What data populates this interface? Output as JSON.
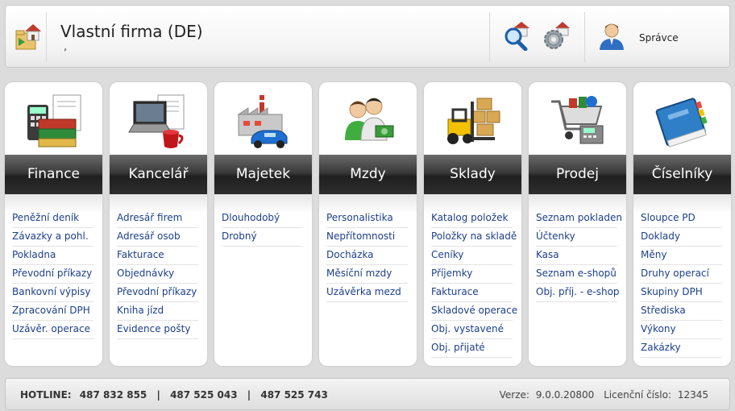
{
  "header": {
    "company": "Vlastní firma (DE)",
    "subline": ",",
    "user": "Správce"
  },
  "modules": [
    {
      "title": "Finance",
      "icon": "finance-icon",
      "links": [
        "Peněžní deník",
        "Závazky a pohl.",
        "Pokladna",
        "Převodní příkazy",
        "Bankovní výpisy",
        "Zpracování DPH",
        "Uzávěr. operace"
      ]
    },
    {
      "title": "Kancelář",
      "icon": "office-icon",
      "links": [
        "Adresář firem",
        "Adresář osob",
        "Fakturace",
        "Objednávky",
        "Převodní příkazy",
        "Kniha jízd",
        "Evidence pošty"
      ]
    },
    {
      "title": "Majetek",
      "icon": "property-icon",
      "links": [
        "Dlouhodobý",
        "Drobný"
      ]
    },
    {
      "title": "Mzdy",
      "icon": "payroll-icon",
      "links": [
        "Personalistika",
        "Nepřítomnosti",
        "Docházka",
        "Měsíční mzdy",
        "Uzávěrka mezd"
      ]
    },
    {
      "title": "Sklady",
      "icon": "warehouse-icon",
      "links": [
        "Katalog položek",
        "Položky na skladě",
        "Ceníky",
        "Příjemky",
        "Fakturace",
        "Skladové operace",
        "Obj. vystavené",
        "Obj. přijaté"
      ]
    },
    {
      "title": "Prodej",
      "icon": "sales-icon",
      "links": [
        "Seznam pokladen",
        "Účtenky",
        "Kasa",
        "Seznam e-shopů",
        "Obj. příj. - e-shop"
      ]
    },
    {
      "title": "Číselníky",
      "icon": "codebook-icon",
      "links": [
        "Sloupce PD",
        "Doklady",
        "Měny",
        "Druhy operací",
        "Skupiny DPH",
        "Střediska",
        "Výkony",
        "Zakázky"
      ]
    }
  ],
  "footer": {
    "hotline_label": "HOTLINE:",
    "phones": [
      "487 832 855",
      "487 525 043",
      "487 525 743"
    ],
    "separator": "|",
    "version_label": "Verze:",
    "version": "9.0.0.20800",
    "license_label": "Licenční číslo:",
    "license": "12345"
  }
}
